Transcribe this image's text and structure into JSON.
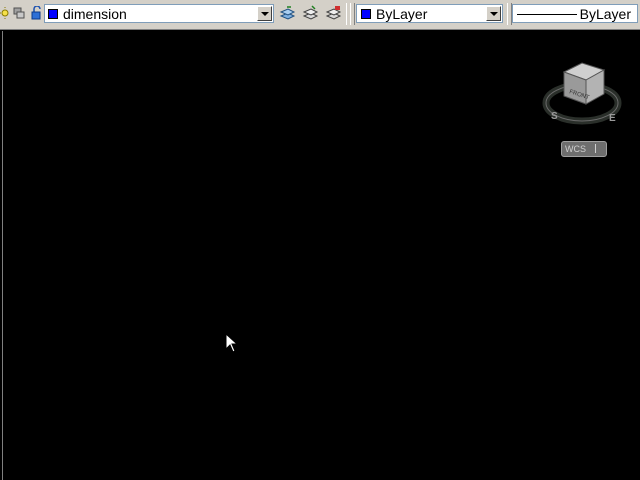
{
  "layer_toolbar": {
    "layer_name": "dimension",
    "layer_color": "#0000ff"
  },
  "properties_toolbar": {
    "color_value": "ByLayer",
    "color_swatch": "#0000ff",
    "linetype_value": "ByLayer"
  },
  "viewcube": {
    "compass_labels": [
      "S",
      "E"
    ],
    "face_label": "FRONT"
  },
  "ucs": {
    "label": "WCS"
  },
  "icons": [
    "sun-icon",
    "layer-state-icon",
    "lock-icon",
    "layer-previous-icon",
    "layer-make-current-icon",
    "layer-isolate-icon",
    "viewcube-icon",
    "mouse-cursor-icon"
  ]
}
